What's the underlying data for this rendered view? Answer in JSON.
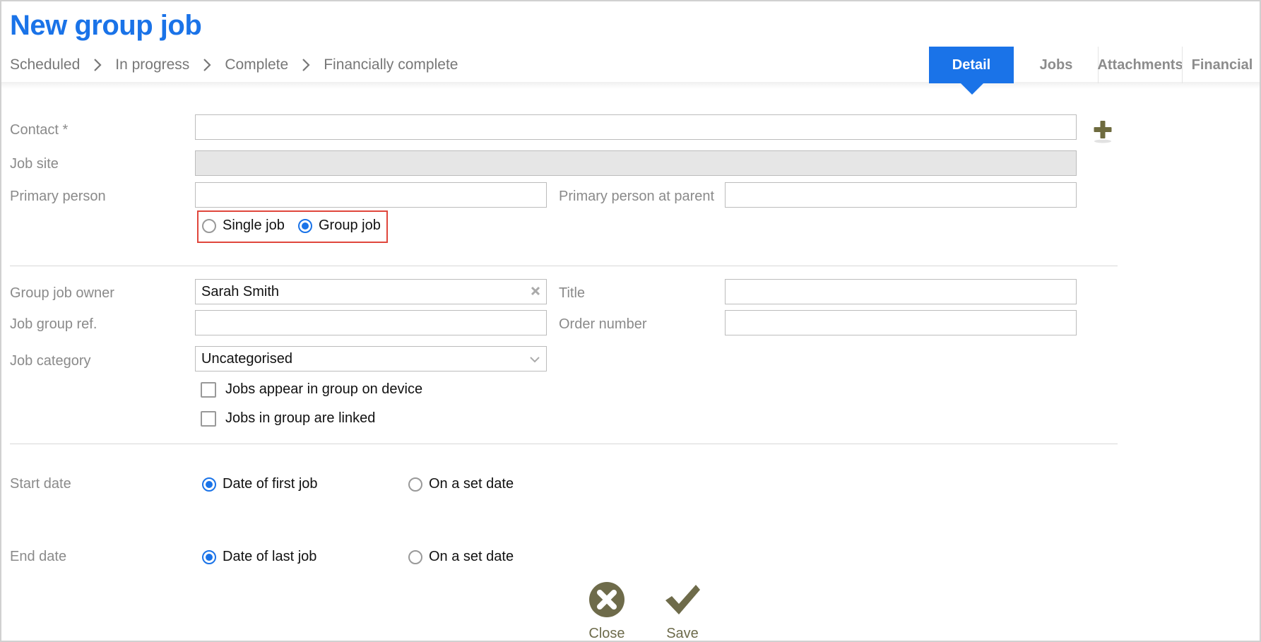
{
  "page": {
    "title": "New group job"
  },
  "breadcrumb": [
    "Scheduled",
    "In progress",
    "Complete",
    "Financially complete"
  ],
  "tabs": [
    {
      "label": "Detail",
      "active": true
    },
    {
      "label": "Jobs",
      "active": false
    },
    {
      "label": "Attachments",
      "active": false
    },
    {
      "label": "Financial",
      "active": false
    }
  ],
  "form": {
    "contact": {
      "label": "Contact *",
      "value": ""
    },
    "job_site": {
      "label": "Job site",
      "value": ""
    },
    "primary_person": {
      "label": "Primary person",
      "value": ""
    },
    "primary_person_parent": {
      "label": "Primary person at parent",
      "value": ""
    },
    "job_type": {
      "options": [
        {
          "label": "Single job",
          "checked": false
        },
        {
          "label": "Group job",
          "checked": true
        }
      ]
    },
    "group_job_owner": {
      "label": "Group job owner",
      "value": "Sarah Smith"
    },
    "title": {
      "label": "Title",
      "value": ""
    },
    "job_group_ref": {
      "label": "Job group ref.",
      "value": ""
    },
    "order_number": {
      "label": "Order number",
      "value": ""
    },
    "job_category": {
      "label": "Job category",
      "value": "Uncategorised"
    },
    "checkboxes": [
      {
        "label": "Jobs appear in group on device",
        "checked": false
      },
      {
        "label": "Jobs in group are linked",
        "checked": false
      }
    ],
    "start_date": {
      "label": "Start date",
      "options": [
        {
          "label": "Date of first job",
          "checked": true
        },
        {
          "label": "On a set date",
          "checked": false
        }
      ]
    },
    "end_date": {
      "label": "End date",
      "options": [
        {
          "label": "Date of last job",
          "checked": true
        },
        {
          "label": "On a set date",
          "checked": false
        }
      ]
    }
  },
  "actions": {
    "close_label": "Close",
    "save_label": "Save"
  },
  "colors": {
    "accent": "#1a73e8",
    "highlight_border": "#e0463c",
    "action_olive": "#6d6b4b"
  },
  "icons": [
    "chevron-right-icon",
    "plus-icon",
    "clear-x-icon",
    "chevron-down-icon",
    "close-circle-icon",
    "checkmark-icon"
  ]
}
